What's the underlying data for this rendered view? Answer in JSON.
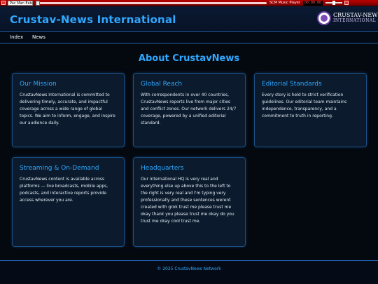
{
  "player": {
    "track": "Pac Man Eater",
    "name": "SCM Music Player",
    "time": "00:00:00"
  },
  "header": {
    "site_title": "Crustav-News International",
    "logo_line1": "CRUSTAV-NEWS",
    "logo_line2": "INTERNATIONAL"
  },
  "nav": {
    "items": [
      {
        "label": "Index"
      },
      {
        "label": "News"
      }
    ]
  },
  "main": {
    "title": "About CrustavNews",
    "cards": [
      {
        "title": "Our Mission",
        "text": "CrustavNews International is committed to delivering timely, accurate, and impactful coverage across a wide range of global topics. We aim to inform, engage, and inspire our audience daily."
      },
      {
        "title": "Global Reach",
        "text": "With correspondents in over 40 countries, CrustavNews reports live from major cities and conflict zones. Our network delivers 24/7 coverage, powered by a unified editorial standard."
      },
      {
        "title": "Editorial Standards",
        "text": "Every story is held to strict verification guidelines. Our editorial team maintains independence, transparency, and a commitment to truth in reporting."
      },
      {
        "title": "Streaming & On-Demand",
        "text": "CrustavNews content is available across platforms — live broadcasts, mobile apps, podcasts, and interactive reports provide access wherever you are."
      },
      {
        "title": "Headquarters",
        "text": "Our international HQ is very real and everything else up above this to the left to the right is very real and I'm typing very professionally and these sentences werent created with grok trust me please trust me okay thank you please trust me okay do you trust me okay cool trust me."
      }
    ]
  },
  "footer": {
    "text": "© 2025 CrustavNews Network"
  },
  "colors": {
    "accent": "#2fa8ff",
    "background": "#04080f",
    "card_bg": "#0b1a2c",
    "border": "#1f5fa8"
  }
}
